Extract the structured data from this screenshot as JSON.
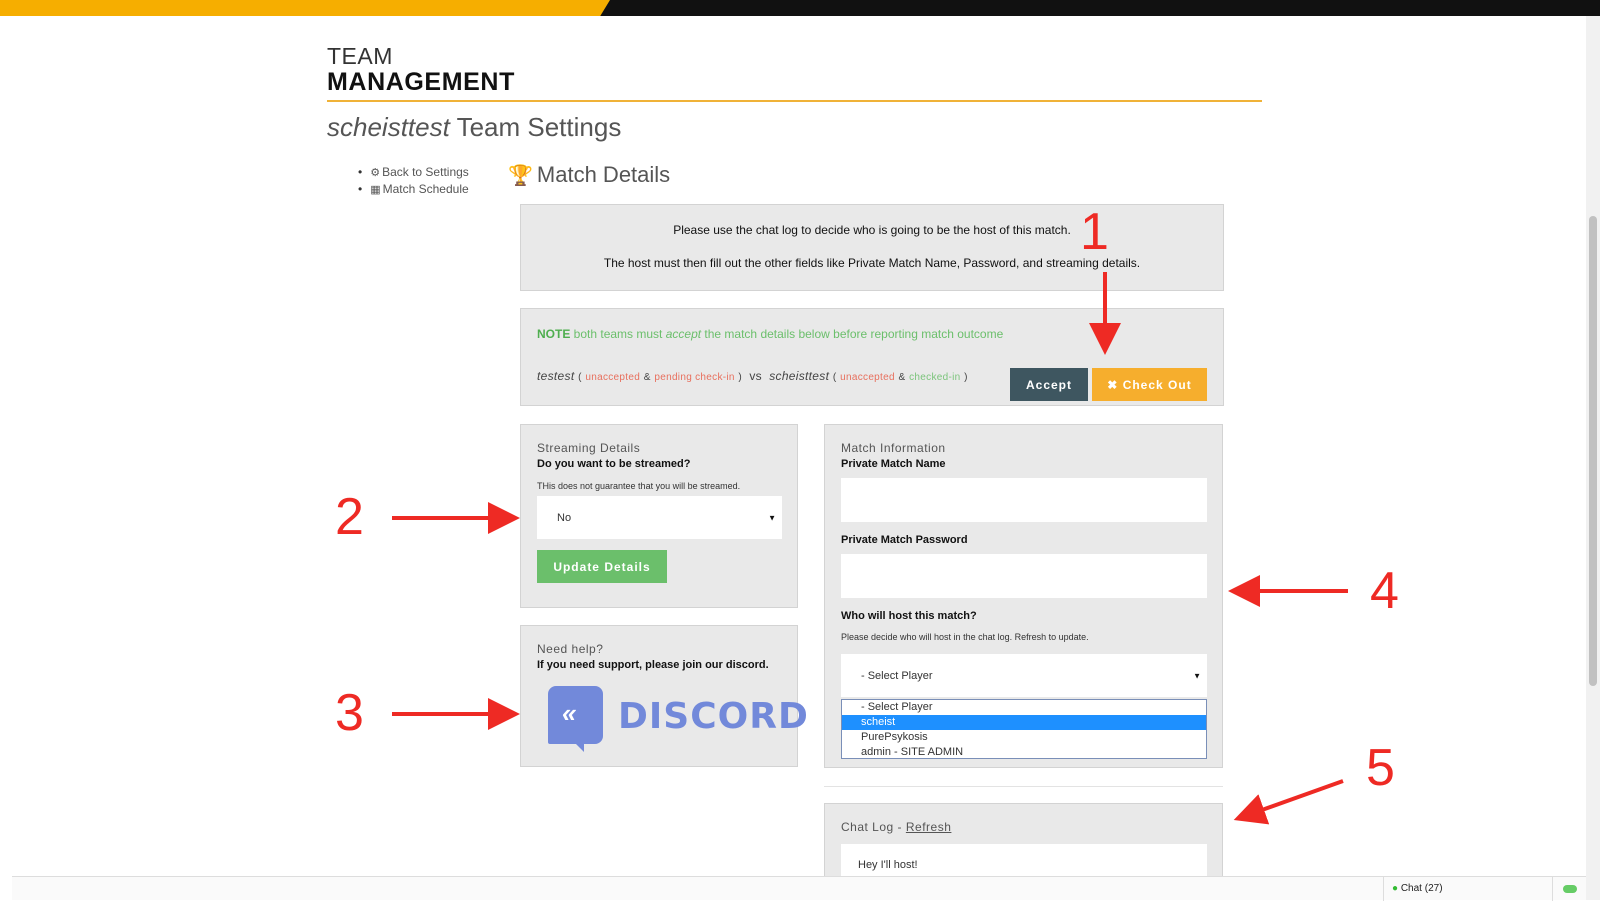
{
  "header": {
    "title_line1": "TEAM",
    "title_line2": "MANAGEMENT"
  },
  "settings": {
    "team_name": "scheisttest",
    "title_suffix": " Team Settings"
  },
  "side_nav": [
    {
      "icon": "gear-icon",
      "label": "Back to Settings"
    },
    {
      "icon": "calendar-icon",
      "label": "Match Schedule"
    }
  ],
  "section": {
    "icon": "trophy-icon",
    "title": "Match Details"
  },
  "info": {
    "line1": "Please use the chat log to decide who is going to be the host of this match.",
    "line2": "The host must then fill out the other fields like Private Match Name, Password, and streaming details."
  },
  "note": {
    "prefix": "NOTE",
    "text_a": " both teams must ",
    "emph": "accept",
    "text_b": " the match details below before reporting match outcome",
    "team1": "testest",
    "team1_status1": "unaccepted",
    "team1_status2": "pending check-in",
    "vs": "vs",
    "team2": "scheisttest",
    "team2_status1": "unaccepted",
    "team2_status2": "checked-in",
    "amp": "&",
    "open_paren": "(",
    "close_paren": ")",
    "accept_label": "Accept",
    "checkout_label": "Check Out",
    "checkout_icon": "✖"
  },
  "streaming": {
    "section_label": "Streaming Details",
    "question": "Do you want to be streamed?",
    "hint": "THis does not guarantee that you will be streamed.",
    "selected": "No",
    "update_label": "Update Details"
  },
  "help": {
    "section_label": "Need help?",
    "text": "If you need support, please join our discord.",
    "logo_word": "DISCORD"
  },
  "match_info": {
    "section_label": "Match Information",
    "name_label": "Private Match Name",
    "name_value": "",
    "password_label": "Private Match Password",
    "password_value": "",
    "host_label": "Who will host this match?",
    "host_hint": "Please decide who will host in the chat log. Refresh to update.",
    "host_selected": "- Select Player",
    "host_options": [
      "- Select Player",
      "scheist",
      "PurePsykosis",
      "admin - SITE ADMIN"
    ],
    "highlighted_option": "scheist"
  },
  "chat_log": {
    "label": "Chat Log - ",
    "refresh_label": "Refresh",
    "message": "Hey I'll host!"
  },
  "chat_bar": {
    "label": "Chat",
    "count": "(27)"
  },
  "annotations": [
    "1",
    "2",
    "3",
    "4",
    "5"
  ],
  "colors": {
    "accent": "#f6ae00",
    "accept_button": "#3e5660",
    "checkout_button": "#f6ae2d",
    "update_button": "#6bbf6b",
    "annotation": "#ee2a24",
    "discord": "#7289da",
    "highlight": "#1e90ff"
  }
}
